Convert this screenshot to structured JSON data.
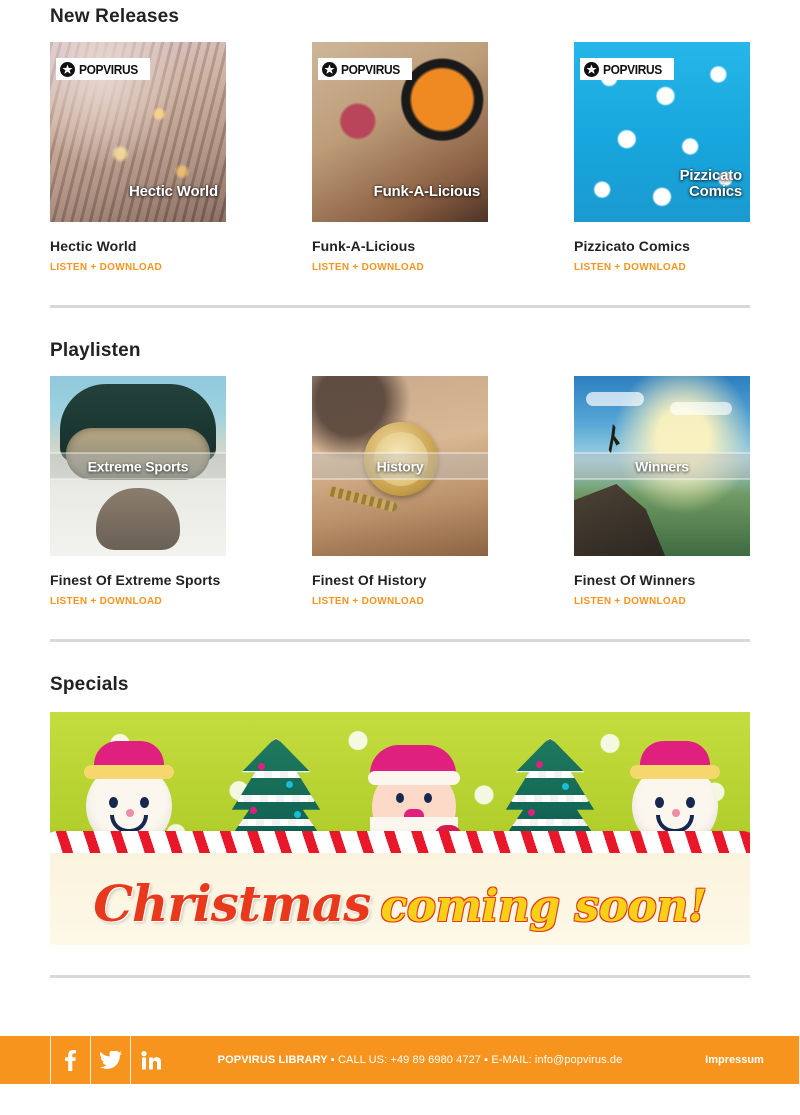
{
  "brand": {
    "name": "POPVIRUS",
    "accent": "#F7941E",
    "logo_icon": "star-circle-icon"
  },
  "sections": {
    "new_releases": {
      "title": "New Releases",
      "cards": [
        {
          "cover_title": "Hectic World",
          "title": "Hectic World",
          "link": "LISTEN + DOWNLOAD"
        },
        {
          "cover_title": "Funk-A-Licious",
          "title": "Funk-A-Licious",
          "link": "LISTEN + DOWNLOAD"
        },
        {
          "cover_title": "Pizzicato\nComics",
          "title": "Pizzicato Comics",
          "link": "LISTEN + DOWNLOAD"
        }
      ]
    },
    "playlists": {
      "title": "Playlisten",
      "cards": [
        {
          "band_label": "Extreme Sports",
          "title": "Finest Of Extreme Sports",
          "link": "LISTEN + DOWNLOAD"
        },
        {
          "band_label": "History",
          "title": "Finest Of History",
          "link": "LISTEN + DOWNLOAD"
        },
        {
          "band_label": "Winners",
          "title": "Finest Of Winners",
          "link": "LISTEN + DOWNLOAD"
        }
      ]
    },
    "specials": {
      "title": "Specials",
      "banner": {
        "headline_a": "Christmas",
        "headline_b": "coming soon!"
      }
    }
  },
  "footer": {
    "social": [
      {
        "name": "facebook-icon",
        "glyph": "f"
      },
      {
        "name": "twitter-icon",
        "glyph": "t"
      },
      {
        "name": "linkedin-icon",
        "glyph": "in"
      }
    ],
    "info_bold": "POPVIRUS LIBRARY",
    "info_rest": " ▪ CALL US: +49 89 6980 4727 ▪ E-MAIL: info@popvirus.de",
    "impressum": "Impressum"
  }
}
